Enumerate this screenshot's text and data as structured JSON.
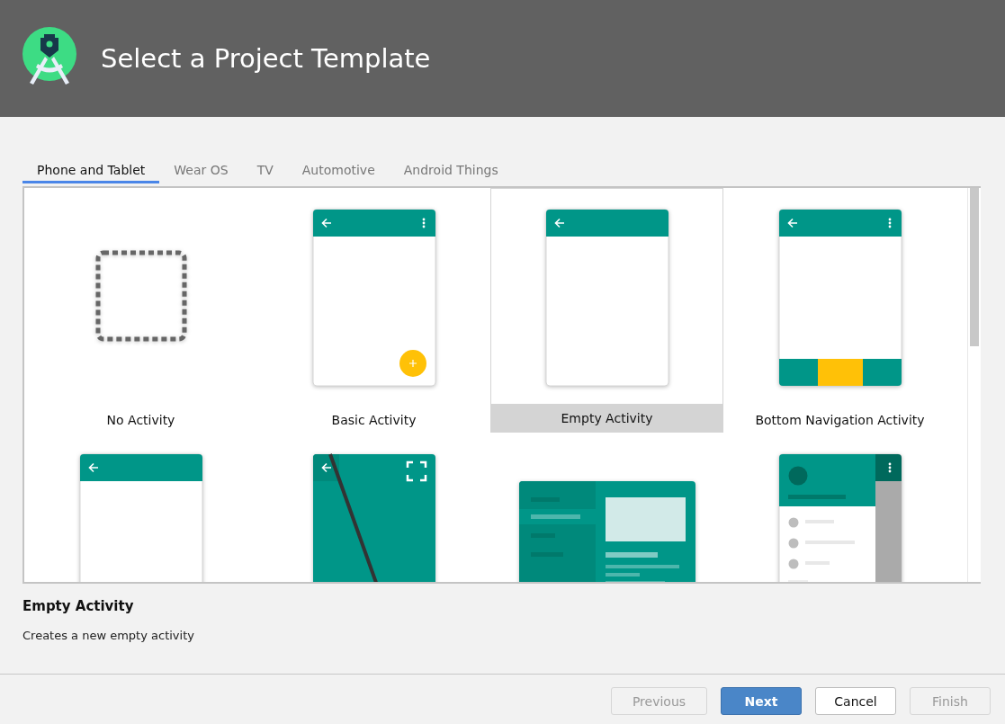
{
  "header": {
    "title": "Select a Project Template"
  },
  "tabs": [
    {
      "label": "Phone and Tablet",
      "selected": true
    },
    {
      "label": "Wear OS",
      "selected": false
    },
    {
      "label": "TV",
      "selected": false
    },
    {
      "label": "Automotive",
      "selected": false
    },
    {
      "label": "Android Things",
      "selected": false
    }
  ],
  "templates": [
    {
      "kind": "none",
      "label": "No Activity",
      "selected": false
    },
    {
      "kind": "basic",
      "label": "Basic Activity",
      "selected": false
    },
    {
      "kind": "empty",
      "label": "Empty Activity",
      "selected": true
    },
    {
      "kind": "bottomnav",
      "label": "Bottom Navigation Activity",
      "selected": false
    },
    {
      "kind": "empty",
      "selected": false
    },
    {
      "kind": "fullscreen",
      "selected": false
    },
    {
      "kind": "masterdetail",
      "selected": false
    },
    {
      "kind": "drawer",
      "selected": false
    }
  ],
  "details": {
    "title": "Empty Activity",
    "description": "Creates a new empty activity"
  },
  "buttons": [
    {
      "label": "Previous",
      "disabled": true,
      "primary": false
    },
    {
      "label": "Next",
      "disabled": false,
      "primary": true
    },
    {
      "label": "Cancel",
      "disabled": false,
      "primary": false
    },
    {
      "label": "Finish",
      "disabled": true,
      "primary": false
    }
  ]
}
